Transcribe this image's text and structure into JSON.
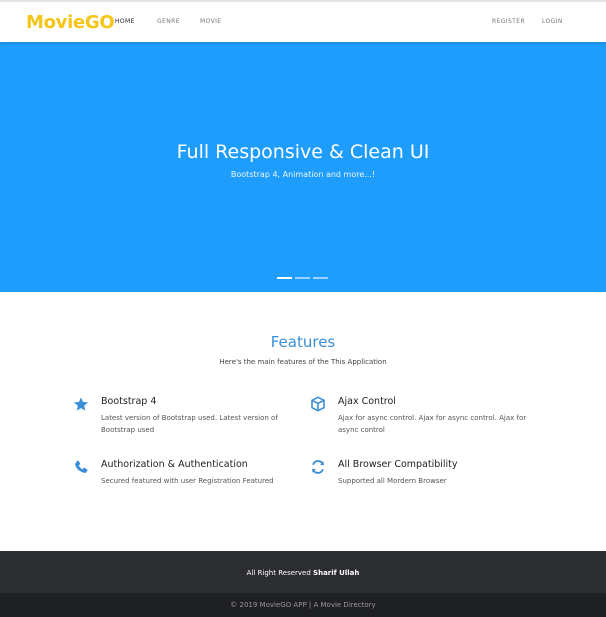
{
  "navbar": {
    "brand": "MovieGO",
    "links": [
      "HOME",
      "GENRE",
      "MOVIE"
    ],
    "right_links": [
      "REGISTER",
      "LOGIN"
    ],
    "brand_color": "#f5c518"
  },
  "hero": {
    "title": "Full Responsive & Clean UI",
    "subtitle": "Bootstrap 4, Animation and more...!",
    "background": "#1f9dfc",
    "slide_count": 3,
    "active_slide": 1
  },
  "features": {
    "title": "Features",
    "subtitle": "Here's the main features of the This Application",
    "items": [
      {
        "icon": "star-icon",
        "title": "Bootstrap 4",
        "description": "Latest version of Bootstrap used. Latest version of Bootstrap used"
      },
      {
        "icon": "cube-icon",
        "title": "Ajax Control",
        "description": "Ajax for async control. Ajax for async control. Ajax for async control"
      },
      {
        "icon": "phone-icon",
        "title": "Authorization & Authentication",
        "description": "Secured featured with user Registration Featured"
      },
      {
        "icon": "refresh-icon",
        "title": "All Browser Compatibility",
        "description": "Supported all Mordern Browser"
      }
    ],
    "accent": "#3a8fd6"
  },
  "footer": {
    "credit_prefix": "All Right Reserved",
    "credit_name": "Sharif Ullah",
    "copyright": "© 2019 MovieGO APP | A Movie Directory"
  }
}
